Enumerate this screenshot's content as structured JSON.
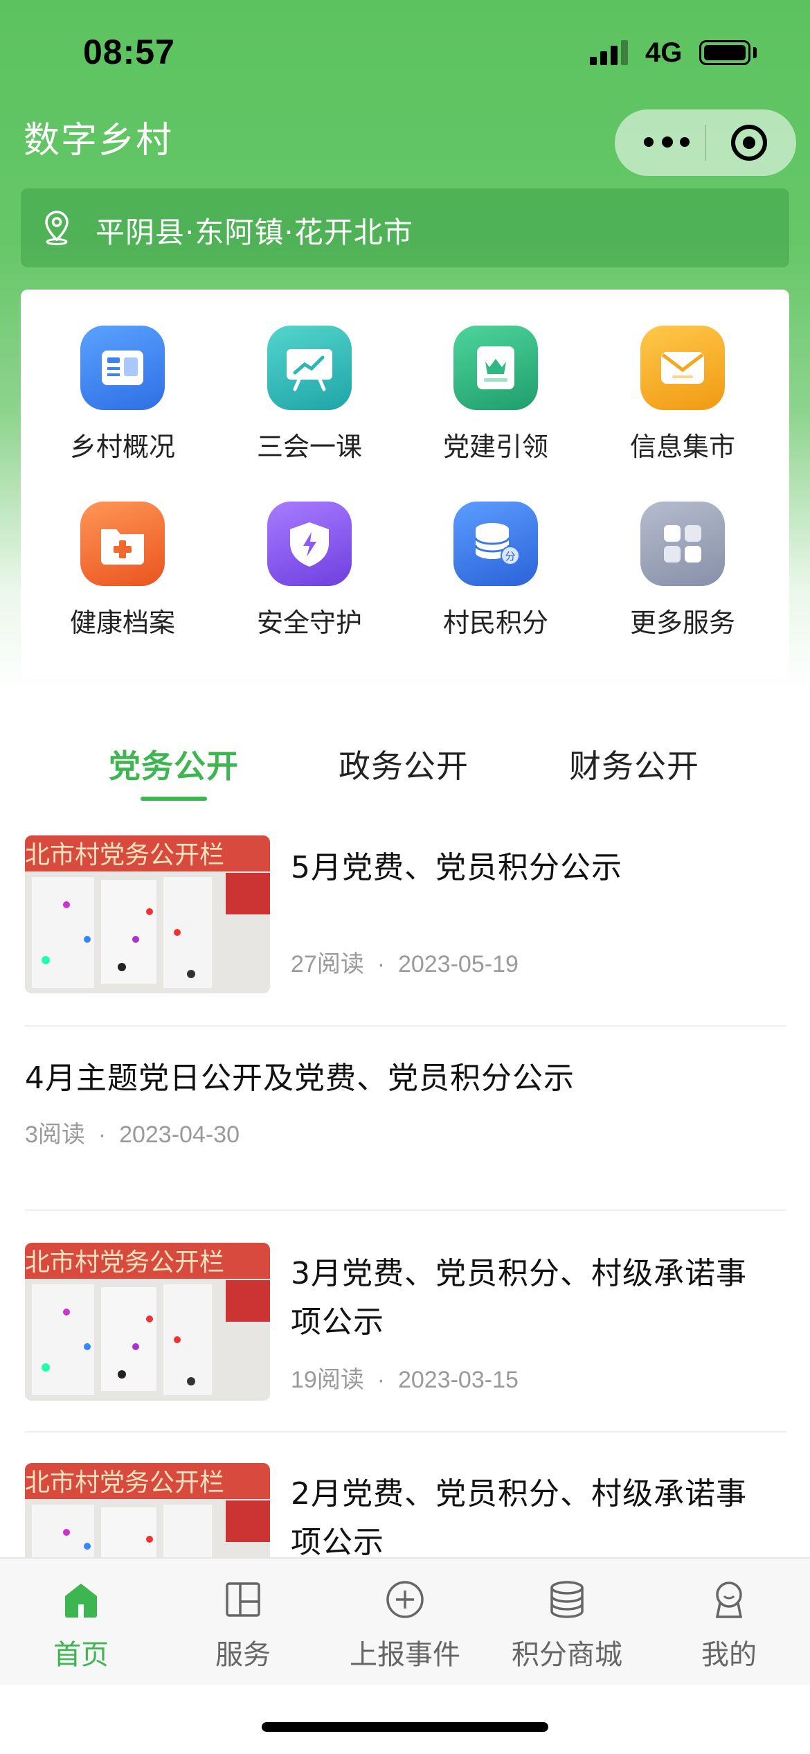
{
  "status_bar": {
    "time": "08:57",
    "network": "4G"
  },
  "header": {
    "title": "数字乡村"
  },
  "location": {
    "text": "平阴县·东阿镇·花开北市"
  },
  "services": [
    {
      "label": "乡村概况",
      "icon": "newspaper-icon",
      "color": "#3b82f0"
    },
    {
      "label": "三会一课",
      "icon": "presentation-board-icon",
      "color": "#2bb7b3"
    },
    {
      "label": "党建引领",
      "icon": "crown-card-icon",
      "color": "#31b781"
    },
    {
      "label": "信息集市",
      "icon": "envelope-icon",
      "color": "#f2a91d"
    },
    {
      "label": "健康档案",
      "icon": "medical-folder-icon",
      "color": "#f06a2e"
    },
    {
      "label": "安全守护",
      "icon": "shield-bolt-icon",
      "color": "#8a5cf0"
    },
    {
      "label": "村民积分",
      "icon": "coin-stack-icon",
      "color": "#3a78e8"
    },
    {
      "label": "更多服务",
      "icon": "grid-more-icon",
      "color": "#9aa3b8"
    }
  ],
  "tabs": [
    {
      "label": "党务公开",
      "active": true
    },
    {
      "label": "政务公开",
      "active": false
    },
    {
      "label": "财务公开",
      "active": false
    }
  ],
  "news": [
    {
      "title": "5月党费、党员积分公示",
      "reads": "27阅读",
      "date": "2023-05-19",
      "has_image": true
    },
    {
      "title": "4月主题党日公开及党费、党员积分公示",
      "reads": "3阅读",
      "date": "2023-04-30",
      "has_image": false
    },
    {
      "title_line1": "3月党费、党员积分、村级承诺事",
      "title_line2": "项公示",
      "reads": "19阅读",
      "date": "2023-03-15",
      "has_image": true
    },
    {
      "title_line1": "2月党费、党员积分、村级承诺事",
      "title_line2": "项公示",
      "has_image": true
    }
  ],
  "meta_separator": "·",
  "thumbnail_banner_text": "北市村党务公开栏",
  "tabbar": [
    {
      "label": "首页",
      "icon": "home-icon",
      "active": true
    },
    {
      "label": "服务",
      "icon": "service-panel-icon",
      "active": false
    },
    {
      "label": "上报事件",
      "icon": "plus-circle-icon",
      "active": false
    },
    {
      "label": "积分商城",
      "icon": "database-icon",
      "active": false
    },
    {
      "label": "我的",
      "icon": "profile-icon",
      "active": false
    }
  ],
  "colors": {
    "accent": "#3db550",
    "header_green": "#5cc25f"
  }
}
